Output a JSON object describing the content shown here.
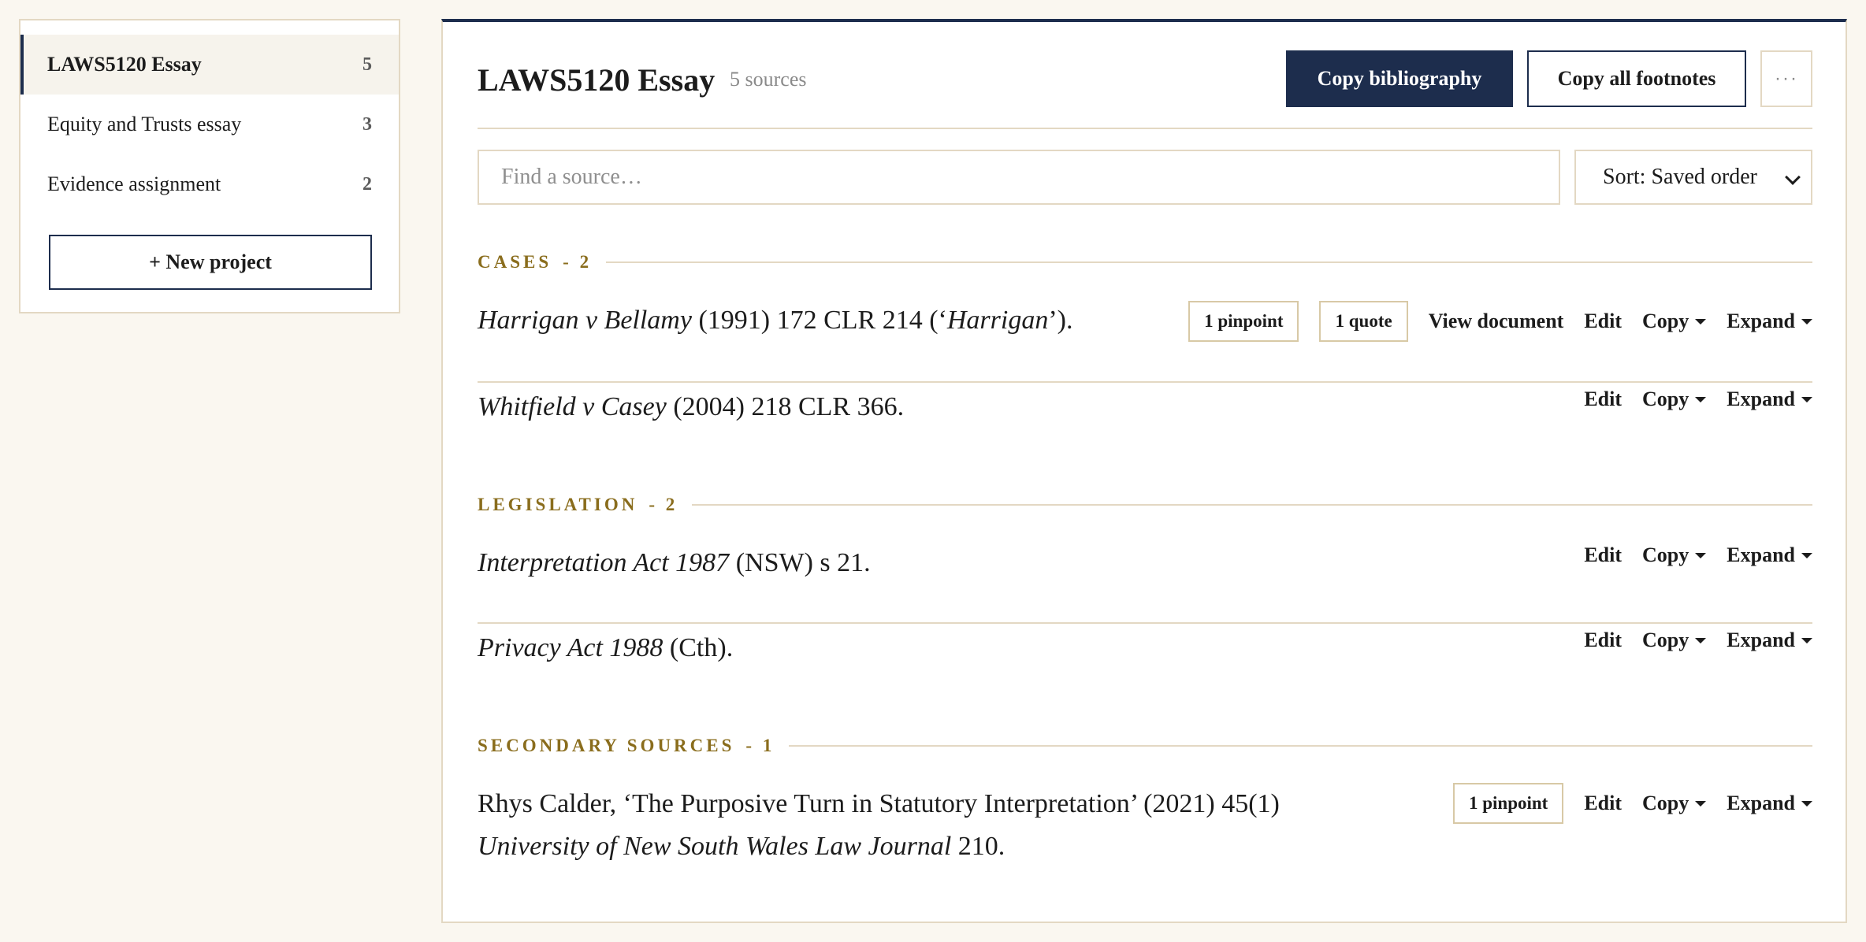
{
  "sidebar": {
    "projects": [
      {
        "name": "LAWS5120 Essay",
        "count": "5"
      },
      {
        "name": "Equity and Trusts essay",
        "count": "3"
      },
      {
        "name": "Evidence assignment",
        "count": "2"
      }
    ],
    "new_project_label": "+ New project"
  },
  "header": {
    "title": "LAWS5120 Essay",
    "source_count": "5 sources",
    "copy_bibliography_label": "Copy bibliography",
    "copy_footnotes_label": "Copy all footnotes",
    "more_label": "···"
  },
  "search": {
    "placeholder": "Find a source…"
  },
  "sort": {
    "label": "Sort: Saved order"
  },
  "actions": {
    "edit": "Edit",
    "copy": "Copy",
    "expand": "Expand",
    "view_document": "View document"
  },
  "sections": [
    {
      "label": "CASES",
      "count": "- 2",
      "items": [
        {
          "title_italic": "Harrigan v Bellamy",
          "rest_a": " (1991) 172 CLR 214 (‘",
          "short_italic": "Harrigan",
          "rest_b": "’).",
          "pinpoint": "1 pinpoint",
          "quote": "1 quote"
        },
        {
          "title_italic": "Whitfield v Casey",
          "rest": " (2004) 218 CLR 366."
        }
      ]
    },
    {
      "label": "LEGISLATION",
      "count": "- 2",
      "items": [
        {
          "title_italic": "Interpretation Act 1987",
          "rest": " (NSW) s 21."
        },
        {
          "title_italic": "Privacy Act 1988",
          "rest": " (Cth)."
        }
      ]
    },
    {
      "label": "SECONDARY SOURCES",
      "count": "- 1",
      "items": [
        {
          "line1": "Rhys Calder, ‘The Purposive Turn in Statutory Interpretation’ (2021) 45(1)",
          "journal_italic": "University of New South Wales Law Journal",
          "rest": " 210.",
          "pinpoint": "1 pinpoint"
        }
      ]
    }
  ]
}
